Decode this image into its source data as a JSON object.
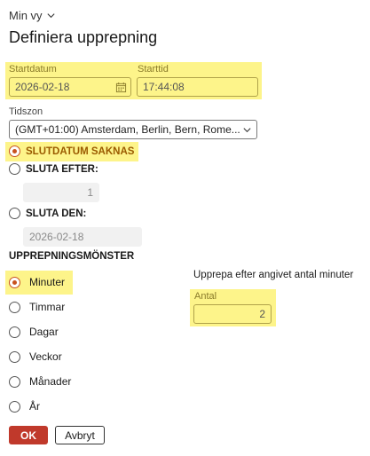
{
  "header": {
    "view_label": "Min vy",
    "title": "Definiera upprepning"
  },
  "start": {
    "date_label": "Startdatum",
    "date_value": "2026-02-18",
    "time_label": "Starttid",
    "time_value": "17:44:08"
  },
  "timezone": {
    "label": "Tidszon",
    "value": "(GMT+01:00) Amsterdam, Berlin, Bern, Rome..."
  },
  "end": {
    "no_end_label": "SLUTDATUM SAKNAS",
    "after_label": "SLUTA EFTER:",
    "after_value": "1",
    "on_label": "SLUTA DEN:",
    "on_value": "2026-02-18",
    "selected": "no_end"
  },
  "pattern": {
    "heading": "UPPREPNINGSMÖNSTER",
    "options": [
      "Minuter",
      "Timmar",
      "Dagar",
      "Veckor",
      "Månader",
      "År"
    ],
    "selected_index": 0,
    "description": "Upprepa efter angivet antal minuter",
    "count_label": "Antal",
    "count_value": "2"
  },
  "actions": {
    "ok_label": "OK",
    "cancel_label": "Avbryt"
  },
  "colors": {
    "highlight": "#fbf38a",
    "accent": "#c8521f",
    "ok_button": "#c0392b"
  }
}
